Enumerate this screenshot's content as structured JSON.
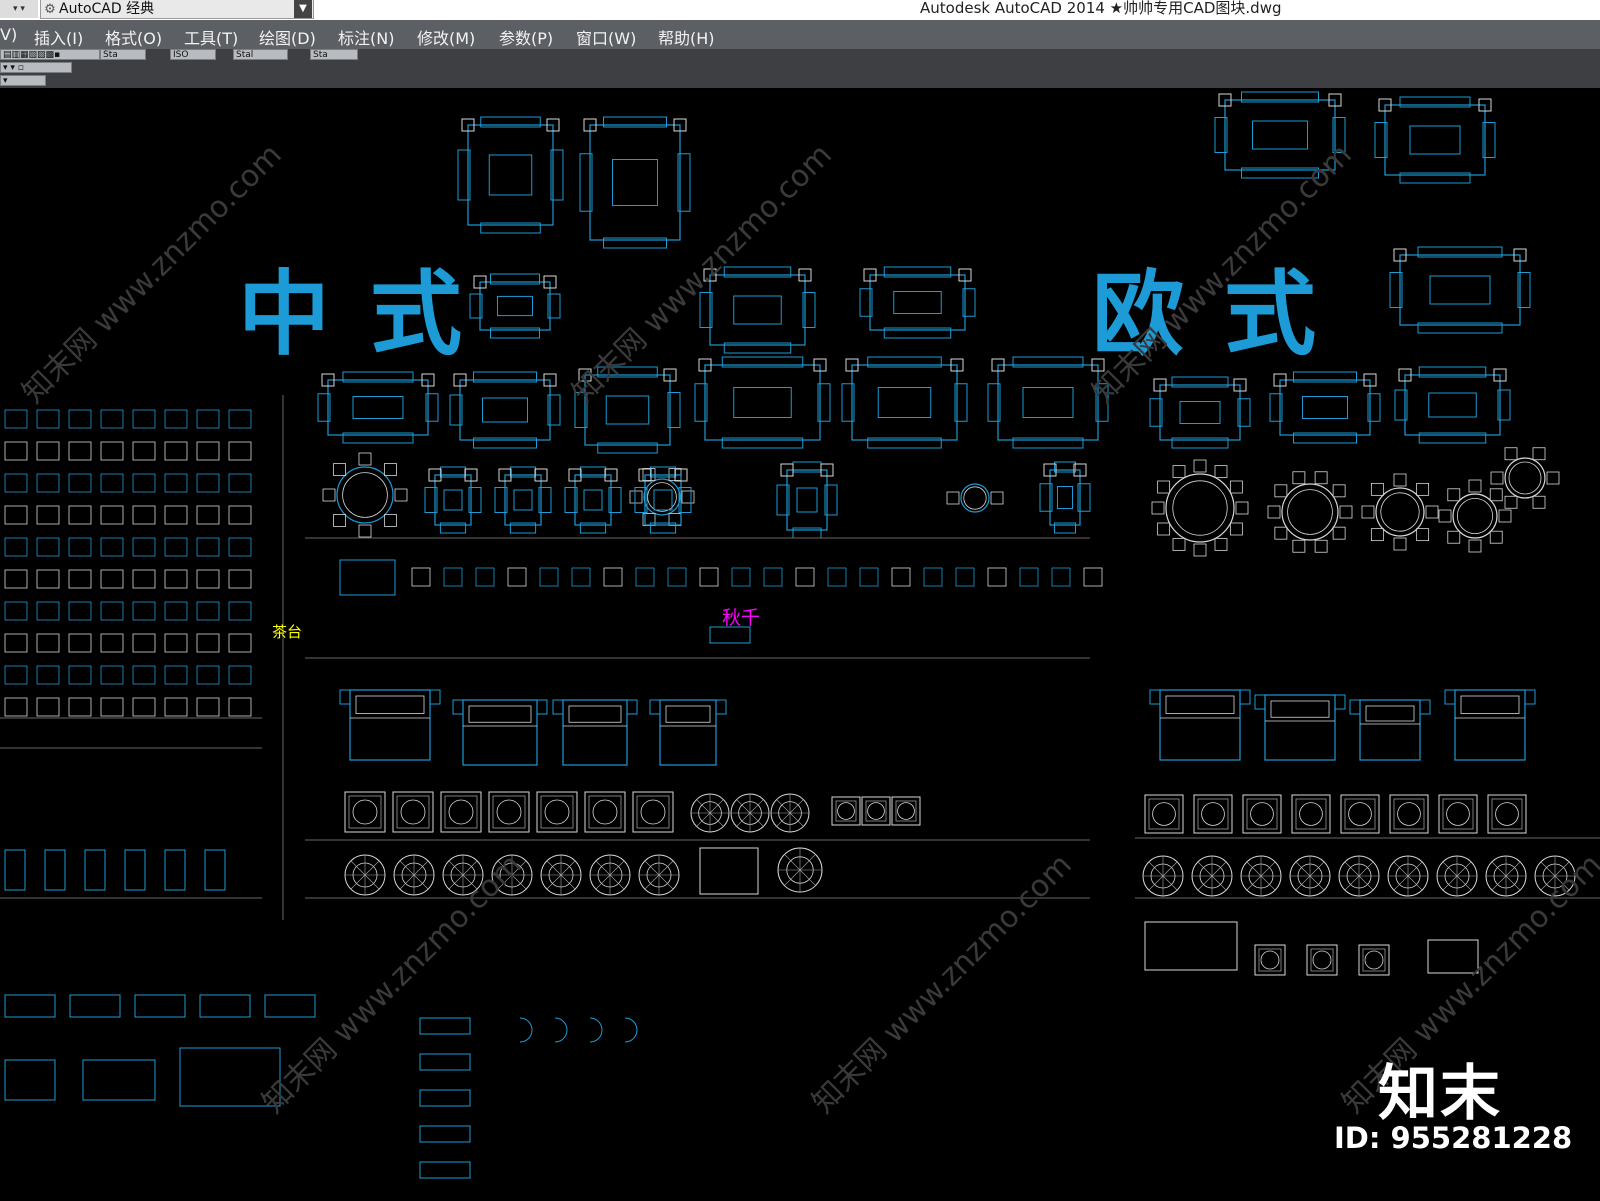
{
  "title_bar": {
    "workspace": "AutoCAD 经典",
    "title": "Autodesk AutoCAD 2014    ★帅帅专用CAD图块.dwg"
  },
  "menu": [
    {
      "label": "V)"
    },
    {
      "label": "插入(I)"
    },
    {
      "label": "格式(O)"
    },
    {
      "label": "工具(T)"
    },
    {
      "label": "绘图(D)"
    },
    {
      "label": "标注(N)"
    },
    {
      "label": "修改(M)"
    },
    {
      "label": "参数(P)"
    },
    {
      "label": "窗口(W)"
    },
    {
      "label": "帮助(H)"
    }
  ],
  "toolbar": {
    "style1": "Sta",
    "style2": "ISO",
    "style3": "Stal",
    "style4": "Sta"
  },
  "canvas": {
    "heading_chinese": "中式",
    "heading_european": "欧式",
    "label_tea": "茶台",
    "label_swing": "秋千",
    "watermark": "知末网 www.znzmo.com"
  },
  "branding": {
    "logo": "知末",
    "id": "ID: 955281228"
  },
  "colors": {
    "canvas_bg": "#000000",
    "cad_cyan": "#1d9bd6",
    "cad_white": "#d8d8d8",
    "label_yellow": "#ffff00",
    "label_magenta": "#ff00ff"
  }
}
